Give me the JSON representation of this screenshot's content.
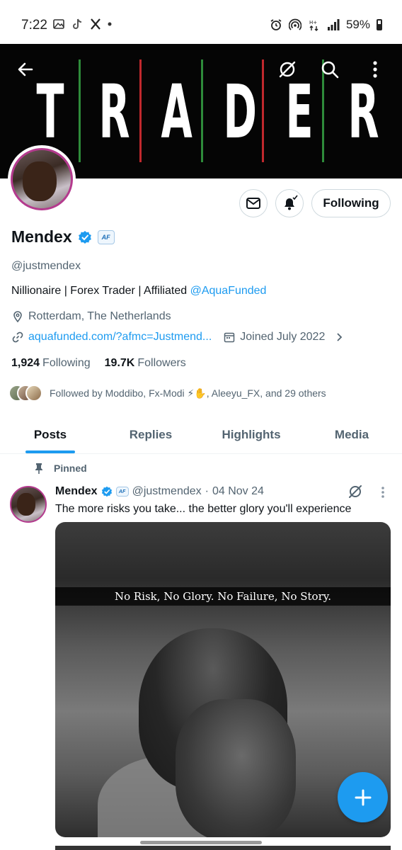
{
  "status_bar": {
    "time": "7:22",
    "battery": "59%",
    "left_icons": [
      "gallery-icon",
      "tiktok-icon",
      "x-icon",
      "dot-icon"
    ],
    "right_icons": [
      "alarm-icon",
      "hotspot-icon",
      "data-icon",
      "signal-icon",
      "battery-icon"
    ]
  },
  "banner": {
    "letters": [
      "T",
      "R",
      "A",
      "D",
      "E",
      "R"
    ],
    "background": "#050505",
    "stripe_colors": [
      "#2e8b3a",
      "#ffffff",
      "#c0282d"
    ]
  },
  "toolbar": {
    "back_icon": "arrow-left-icon",
    "grok_icon": "grok-icon",
    "search_icon": "search-icon",
    "more_icon": "more-vertical-icon"
  },
  "profile": {
    "name": "Mendex",
    "affiliate_badge": "AF",
    "handle": "@justmendex",
    "bio_text": "Nillionaire | Forex Trader | Affiliated ",
    "bio_link": "@AquaFunded",
    "location": "Rotterdam, The Netherlands",
    "website": "aquafunded.com/?afmc=Justmend...",
    "joined": "Joined July 2022",
    "following_count": "1,924",
    "following_label": "Following",
    "followers_count": "19.7K",
    "followers_label": "Followers",
    "followed_by": "Followed by Moddibo, Fx-Modi ⚡✋, Aleeyu_FX, and 29 others"
  },
  "actions": {
    "following_button": "Following",
    "message_icon": "mail-icon",
    "notify_icon": "bell-icon"
  },
  "tabs": [
    {
      "label": "Posts",
      "active": true
    },
    {
      "label": "Replies",
      "active": false
    },
    {
      "label": "Highlights",
      "active": false
    },
    {
      "label": "Media",
      "active": false
    }
  ],
  "post": {
    "pinned_label": "Pinned",
    "author": "Mendex",
    "badge": "AF",
    "handle": "@justmendex",
    "separator": "·",
    "date": "04 Nov 24",
    "text": "The more risks you take... the better glory you'll experience",
    "media_caption": "No Risk, No Glory. No Failure, No Story."
  },
  "fab": {
    "icon": "plus-icon"
  },
  "colors": {
    "accent": "#1d9bf0",
    "text_primary": "#0f1419",
    "text_secondary": "#536471",
    "border": "#cfd9de"
  }
}
